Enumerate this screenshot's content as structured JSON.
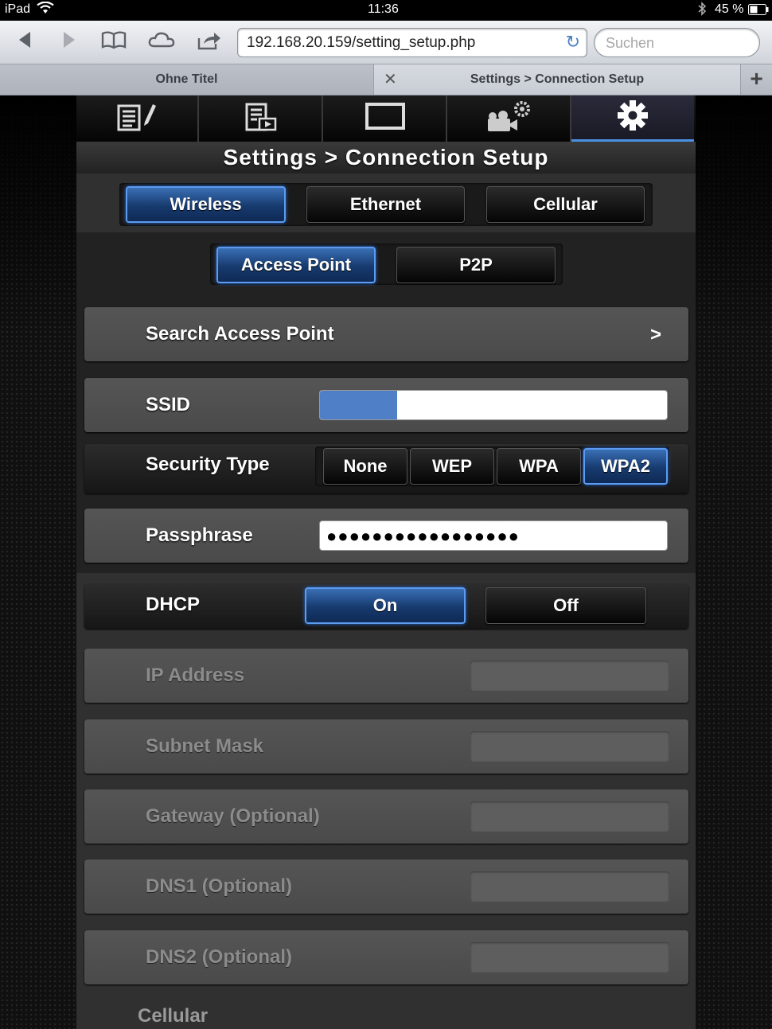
{
  "status_bar": {
    "device": "iPad",
    "time": "11:36",
    "battery": "45 %"
  },
  "browser": {
    "url": "192.168.20.159/setting_setup.php",
    "search_placeholder": "Suchen",
    "tabs": [
      {
        "label": "Ohne Titel"
      },
      {
        "label": "Settings > Connection Setup"
      }
    ]
  },
  "app": {
    "icon_tabs": [
      "edit-icon",
      "playlist-icon",
      "screen-icon",
      "camera-settings-icon",
      "gear-icon"
    ],
    "active_icon_tab": "gear-icon",
    "title": "Settings > Connection Setup",
    "connection_types": [
      "Wireless",
      "Ethernet",
      "Cellular"
    ],
    "selected_connection": "Wireless",
    "wireless_modes": [
      "Access Point",
      "P2P"
    ],
    "selected_mode": "Access Point",
    "search_ap": {
      "label": "Search Access Point",
      "chevron": ">"
    },
    "ssid": {
      "label": "SSID"
    },
    "security": {
      "label": "Security Type",
      "options": [
        "None",
        "WEP",
        "WPA",
        "WPA2"
      ],
      "selected": "WPA2"
    },
    "passphrase": {
      "label": "Passphrase",
      "value": "●●●●●●●●●●●●●●●●●"
    },
    "dhcp": {
      "label": "DHCP",
      "on": "On",
      "off": "Off",
      "selected": "On"
    },
    "disabled_fields": [
      "IP Address",
      "Subnet Mask",
      "Gateway (Optional)",
      "DNS1 (Optional)",
      "DNS2 (Optional)"
    ],
    "section_cellular": "Cellular"
  },
  "colors": {
    "accent_blue": "#3a6fb5",
    "app_bg": "#303030"
  }
}
